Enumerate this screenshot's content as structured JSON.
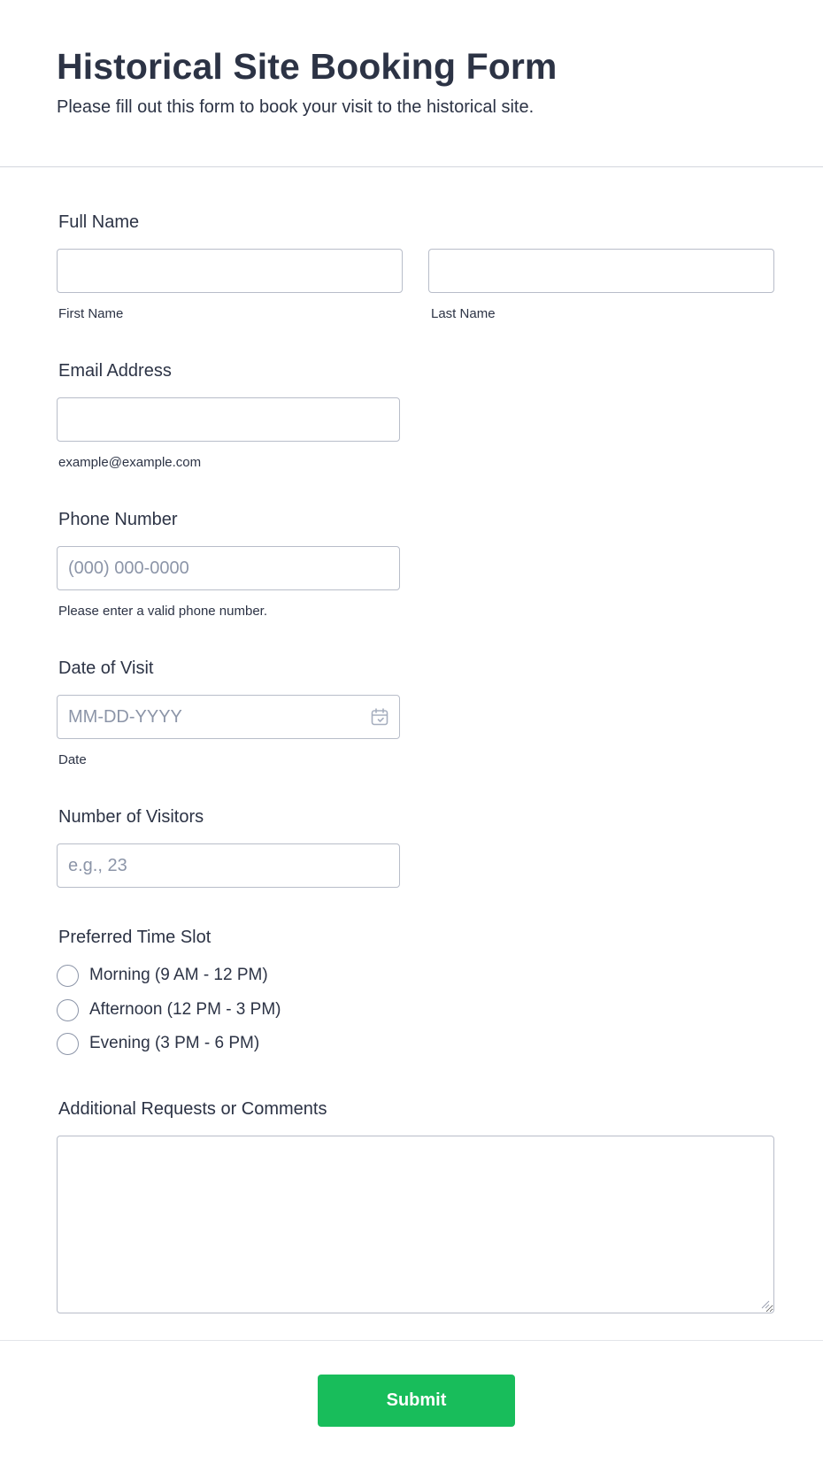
{
  "form": {
    "title": "Historical Site Booking Form",
    "subtitle": "Please fill out this form to book your visit to the historical site."
  },
  "full_name": {
    "label": "Full Name",
    "first_sublabel": "First Name",
    "last_sublabel": "Last Name",
    "first_value": "",
    "last_value": ""
  },
  "email": {
    "label": "Email Address",
    "sublabel": "example@example.com",
    "value": ""
  },
  "phone": {
    "label": "Phone Number",
    "placeholder": "(000) 000-0000",
    "sublabel": "Please enter a valid phone number."
  },
  "date": {
    "label": "Date of Visit",
    "placeholder": "MM-DD-YYYY",
    "sublabel": "Date",
    "icon": "calendar-icon"
  },
  "visitors": {
    "label": "Number of Visitors",
    "placeholder": "e.g., 23"
  },
  "time_slot": {
    "label": "Preferred Time Slot",
    "options": [
      "Morning (9 AM - 12 PM)",
      "Afternoon (12 PM - 3 PM)",
      "Evening (3 PM - 6 PM)"
    ]
  },
  "comments": {
    "label": "Additional Requests or Comments",
    "value": ""
  },
  "submit": {
    "label": "Submit"
  },
  "colors": {
    "text": "#2c3345",
    "border": "#b8bdc9",
    "placeholder": "#8c95a8",
    "submit_bg": "#18bd5b"
  }
}
